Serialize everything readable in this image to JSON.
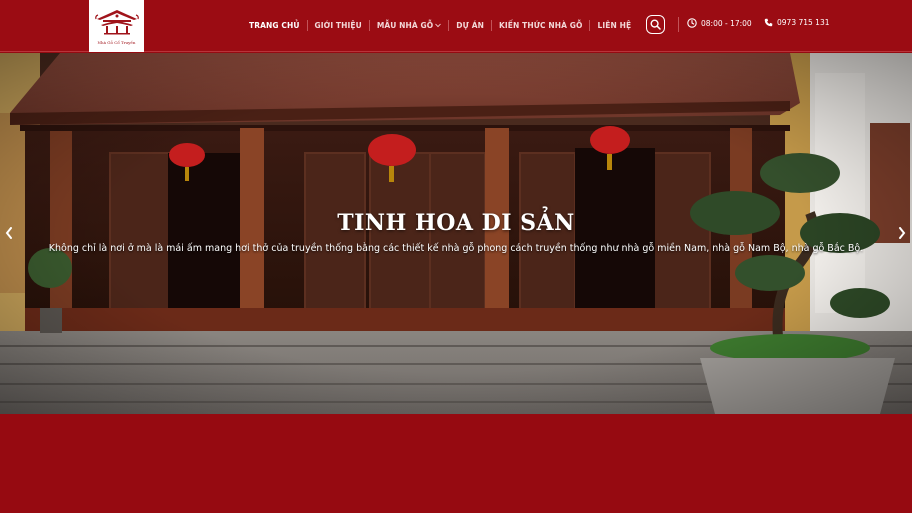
{
  "header": {
    "logo_text": "Nhà Gỗ Cổ Truyền",
    "nav": [
      {
        "label": "TRANG CHỦ",
        "active": true
      },
      {
        "label": "GIỚI THIỆU"
      },
      {
        "label": "MẪU NHÀ GỖ",
        "dropdown": true
      },
      {
        "label": "DỰ ÁN"
      },
      {
        "label": "KIẾN THỨC NHÀ GỖ"
      },
      {
        "label": "LIÊN HỆ"
      }
    ],
    "hours": "08:00 - 17:00",
    "phone": "0973 715 131"
  },
  "hero": {
    "title": "TINH HOA DI SẢN",
    "subtitle": "Không chỉ là nơi ở mà là mái ấm mang hơi thở của truyền thống bằng các thiết kế nhà gỗ phong cách truyền thống như nhà gỗ miền Nam, nhà gỗ Nam Bộ, nhà gỗ Bắc Bộ."
  },
  "colors": {
    "brand_red": "#9b0c13",
    "page_background": "#960a11",
    "text_white": "#ffffff"
  },
  "icons": [
    "logo-temple-icon",
    "chevron-down-icon",
    "search-icon",
    "clock-icon",
    "phone-icon",
    "chevron-left-icon",
    "chevron-right-icon"
  ]
}
